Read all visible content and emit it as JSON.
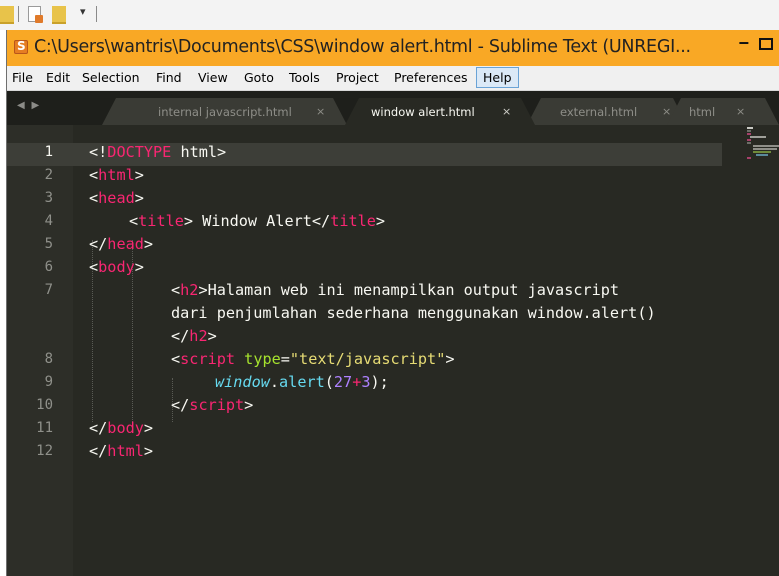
{
  "window": {
    "title": "C:\\Users\\wantris\\Documents\\CSS\\window alert.html - Sublime Text (UNREGI...",
    "minimize_glyph": "−",
    "titlebar_color": "#f9a825"
  },
  "quick_access": {
    "dropdown_glyph": "▾"
  },
  "menu": [
    "File",
    "Edit",
    "Selection",
    "Find",
    "View",
    "Goto",
    "Tools",
    "Project",
    "Preferences",
    "Help"
  ],
  "tabs": {
    "nav_arrows": "◀ ▶",
    "items": [
      {
        "label": "internal javascript.html",
        "close": "×"
      },
      {
        "label": "window alert.html",
        "close": "×",
        "active": true
      },
      {
        "label": "external.html",
        "close": "×"
      },
      {
        "label": "html",
        "close": "×"
      }
    ]
  },
  "editor": {
    "line_numbers": [
      "1",
      "2",
      "3",
      "4",
      "5",
      "6",
      "7",
      "8",
      "9",
      "10",
      "11",
      "12"
    ],
    "current_line": "1",
    "code": {
      "l1_open": "<!",
      "l1_doctype": "DOCTYPE",
      "l1_rest": " html>",
      "l2_open": "<",
      "l2_tag": "html",
      "l2_close": ">",
      "l3_open": "<",
      "l3_tag": "head",
      "l3_close": ">",
      "l4_open": "<",
      "l4_tag": "title",
      "l4_text": "> Window Alert</",
      "l4_tag2": "title",
      "l4_close": ">",
      "l5_open": "</",
      "l5_tag": "head",
      "l5_close": ">",
      "l6_open": "<",
      "l6_tag": "body",
      "l6_close": ">",
      "l7_open": "<",
      "l7_tag": "h2",
      "l7_text": ">Halaman web ini menampilkan output javascript",
      "l7_wrap": "dari penjumlahan sederhana menggunakan window.alert()",
      "l7_end_open": "</",
      "l7_end_tag": "h2",
      "l7_end_close": ">",
      "l8_open": "<",
      "l8_tag": "script",
      "l8_attr": " type",
      "l8_eq": "=",
      "l8_str": "\"text/javascript\"",
      "l8_close": ">",
      "l9_obj": "window",
      "l9_dot": ".",
      "l9_fn": "alert",
      "l9_paren": "(",
      "l9_n1": "27",
      "l9_op": "+",
      "l9_n2": "3",
      "l9_end": ");",
      "l10_open": "</",
      "l10_tag": "script",
      "l10_close": ">",
      "l11_open": "</",
      "l11_tag": "body",
      "l11_close": ">",
      "l12_open": "</",
      "l12_tag": "html",
      "l12_close": ">"
    },
    "colors": {
      "background": "#282923",
      "tag": "#f92672",
      "attr": "#a6e22e",
      "string": "#e6db74",
      "number": "#ae81ff",
      "object": "#66d9ef",
      "text": "#f8f8f2"
    }
  }
}
